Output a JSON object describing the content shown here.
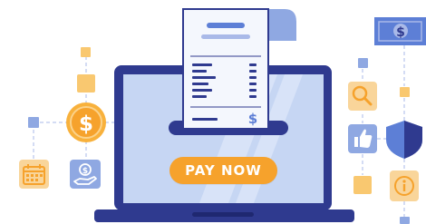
{
  "pay_button": {
    "label": "PAY NOW"
  },
  "receipt": {
    "currency_symbol": "$"
  },
  "coin": {
    "currency_symbol": "$"
  },
  "banknote": {
    "currency_symbol": "$"
  },
  "icons": [
    "coin-dollar-icon",
    "calendar-icon",
    "hand-money-icon",
    "banknote-icon",
    "magnifier-icon",
    "thumbs-up-icon",
    "shield-icon",
    "info-icon",
    "receipt-icon",
    "laptop-icon"
  ],
  "colors": {
    "navy": "#2f3a8f",
    "screen_blue": "#c6d6f3",
    "orange": "#f6a22c",
    "light_orange": "#f9d59a",
    "light_blue": "#8fa8e2",
    "accent_blue": "#5d7fd6"
  }
}
